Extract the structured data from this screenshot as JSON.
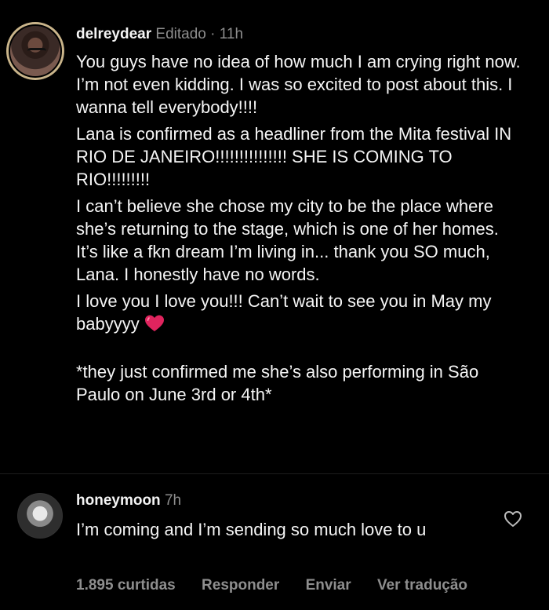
{
  "post": {
    "username": "delreydear",
    "edited_label": "Editado",
    "separator": "·",
    "time": "11h",
    "paragraphs": [
      "You guys have no idea of how much I am crying right now. I’m not even kidding. I was so excited to post about this. I wanna tell everybody!!!!",
      "Lana is confirmed as a headliner from the Mita festival IN RIO DE JANEIRO!!!!!!!!!!!!!!! SHE IS COMING TO RIO!!!!!!!!!",
      "I can’t believe she chose my city to be the place where she’s returning to the stage, which is one of her homes. It’s like a fkn dream I’m living in... thank you SO much, Lana. I honestly have no words.",
      "I love you I love you!!! Can’t wait to see you in May my babyyyy",
      "*they just confirmed me she’s also performing in São Paulo on June 3rd or 4th*"
    ],
    "avatar_icon": "profile-avatar"
  },
  "reply": {
    "username": "honeymoon",
    "time": "7h",
    "text": "I’m coming and I’m sending so much love to u",
    "like_icon": "heart-outline-icon",
    "avatar_icon": "profile-avatar"
  },
  "actions": {
    "likes": "1.895 curtidas",
    "reply": "Responder",
    "send": "Enviar",
    "translate": "Ver tradução"
  },
  "colors": {
    "background": "#000000",
    "text": "#f5f5f5",
    "muted": "#8e8e8e",
    "heart_emoji": "#e0245e"
  }
}
